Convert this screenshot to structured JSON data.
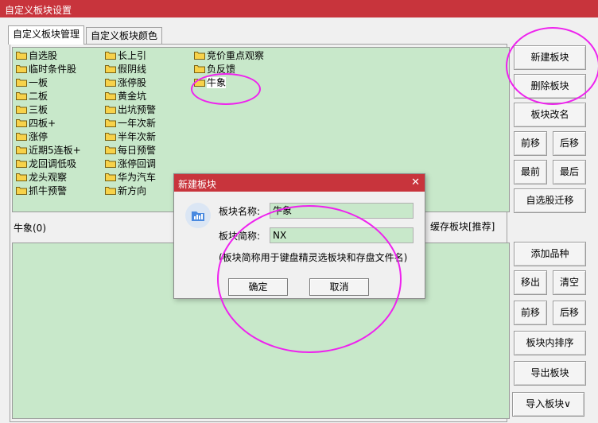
{
  "window": {
    "title": "自定义板块设置"
  },
  "tabs": [
    {
      "label": "自定义板块管理",
      "active": true
    },
    {
      "label": "自定义板块颜色",
      "active": false
    }
  ],
  "blocks": {
    "col1": [
      "自选股",
      "临时条件股",
      "一板",
      "二板",
      "三板",
      "四板+",
      "涨停",
      "近期5连板+",
      "龙回调低吸",
      "龙头观察",
      "抓牛预警"
    ],
    "col2": [
      "长上引",
      "假阴线",
      "涨停股",
      "黄金坑",
      "出坑预警",
      "一年次新",
      "半年次新",
      "每日预警",
      "涨停回调",
      "华为汽车",
      "新方向"
    ],
    "col3": [
      "竞价重点观察",
      "负反馈",
      "牛象"
    ],
    "selected": "牛象"
  },
  "current_block_label": "牛象(0)",
  "cache_label": "缓存板块[推荐]",
  "right_buttons_top": {
    "new": "新建板块",
    "delete": "删除板块",
    "rename": "板块改名",
    "move_up": "前移",
    "move_down": "后移",
    "move_first": "最前",
    "move_last": "最后",
    "migrate": "自选股迁移"
  },
  "right_buttons_bottom": {
    "add": "添加品种",
    "remove": "移出",
    "clear": "清空",
    "move_up": "前移",
    "move_down": "后移",
    "sort": "板块内排序",
    "export": "导出板块",
    "import": "导入板块∨"
  },
  "dialog": {
    "title": "新建板块",
    "name_label": "板块名称:",
    "name_value": "牛象",
    "short_label": "板块简称:",
    "short_value": "NX",
    "hint": "(板块简称用于键盘精灵选板块和存盘文件名)",
    "ok": "确定",
    "cancel": "取消",
    "close": "✕"
  },
  "colors": {
    "titlebar": "#c8343c",
    "list_bg": "#c8e8ca",
    "highlight_ring": "#ee22ee"
  }
}
